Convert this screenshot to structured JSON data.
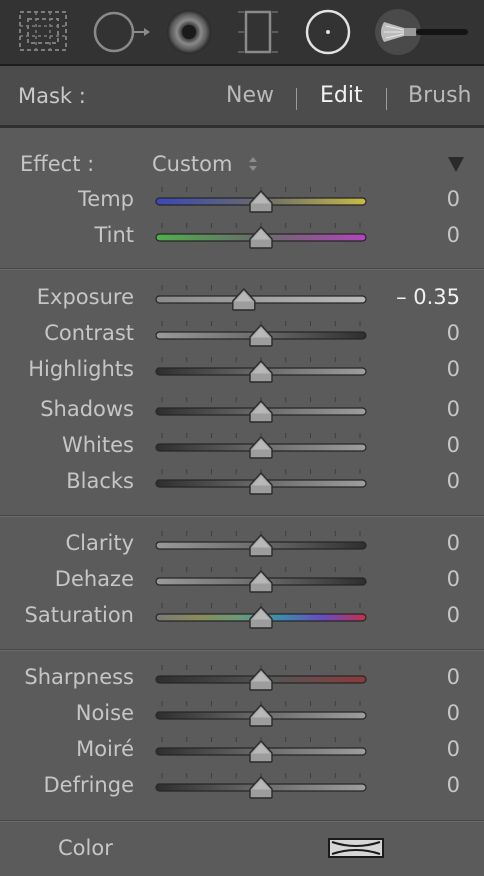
{
  "tools": [
    {
      "icon": "crop-overlay-icon"
    },
    {
      "icon": "spot-removal-icon"
    },
    {
      "icon": "red-eye-icon"
    },
    {
      "icon": "graduated-filter-icon"
    },
    {
      "icon": "radial-filter-icon"
    },
    {
      "icon": "adjustment-brush-icon"
    }
  ],
  "mask": {
    "label": "Mask :",
    "options": [
      "New",
      "Edit",
      "Brush"
    ],
    "active": "Edit"
  },
  "effect": {
    "label": "Effect :",
    "value": "Custom"
  },
  "sliders": [
    {
      "label": "Temp",
      "value": "0",
      "level": 0.0,
      "track": "temp"
    },
    {
      "label": "Tint",
      "value": "0",
      "level": 0.0,
      "track": "tint"
    },
    {
      "label": "Exposure",
      "value": "– 0.35",
      "level": -0.35,
      "track": "plain-light"
    },
    {
      "label": "Contrast",
      "value": "0",
      "level": 0.0,
      "track": "light-dark"
    },
    {
      "label": "Highlights",
      "value": "0",
      "level": 0.0,
      "track": "dark-light"
    },
    {
      "label": "Shadows",
      "value": "0",
      "level": 0.0,
      "track": "dark-light"
    },
    {
      "label": "Whites",
      "value": "0",
      "level": 0.0,
      "track": "dark-light"
    },
    {
      "label": "Blacks",
      "value": "0",
      "level": 0.0,
      "track": "dark-light"
    },
    {
      "label": "Clarity",
      "value": "0",
      "level": 0.0,
      "track": "light-dark"
    },
    {
      "label": "Dehaze",
      "value": "0",
      "level": 0.0,
      "track": "light-dark"
    },
    {
      "label": "Saturation",
      "value": "0",
      "level": 0.0,
      "track": "saturation"
    },
    {
      "label": "Sharpness",
      "value": "0",
      "level": 0.0,
      "track": "sharpness"
    },
    {
      "label": "Noise",
      "value": "0",
      "level": 0.0,
      "track": "dark-light"
    },
    {
      "label": "Moiré",
      "value": "0",
      "level": 0.0,
      "track": "dark-light"
    },
    {
      "label": "Defringe",
      "value": "0",
      "level": 0.0,
      "track": "dark-light"
    }
  ],
  "color": {
    "label": "Color",
    "swatch": "none"
  },
  "colors": {
    "panel": "#5b5b5b",
    "toolbar": "#333333",
    "text": "#c6c6c6",
    "active_text": "#f2f2f2",
    "temp_blue": "#3b47b8",
    "temp_yellow": "#c8bc45",
    "tint_green": "#4fb04d",
    "tint_magenta": "#b344bb"
  }
}
